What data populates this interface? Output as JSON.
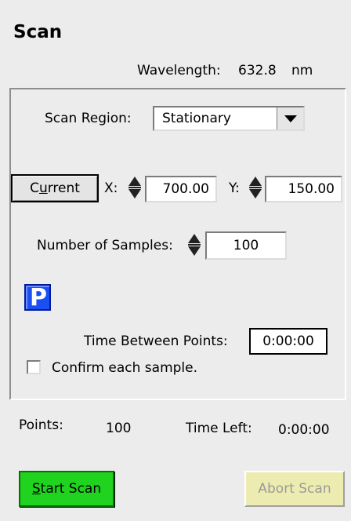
{
  "panel": {
    "title": "Scan",
    "wavelength_label": "Wavelength:",
    "wavelength_value": "632.8",
    "wavelength_unit": "nm"
  },
  "scan_region": {
    "label": "Scan Region:",
    "selected": "Stationary"
  },
  "position": {
    "current_label_pre": "C",
    "current_label_ul": "u",
    "current_label_post": "rrent",
    "x_label": "X:",
    "x_value": "700.00",
    "y_label": "Y:",
    "y_value": "150.00"
  },
  "samples": {
    "label": "Number of Samples:",
    "value": "100"
  },
  "pause_icon": {
    "glyph": "P",
    "icon": "pause-p-icon",
    "color": "#1c4ff2"
  },
  "timing": {
    "label": "Time Between Points:",
    "value": "0:00:00"
  },
  "confirm": {
    "label": "Confirm each sample.",
    "checked": false
  },
  "status": {
    "points_label": "Points:",
    "points_value": "100",
    "time_left_label": "Time Left:",
    "time_left_value": "0:00:00"
  },
  "actions": {
    "start_ul": "S",
    "start_rest": "tart Scan",
    "start_color": "#1fd31f",
    "abort_label": "Abort Scan",
    "abort_color": "#ececb0"
  }
}
